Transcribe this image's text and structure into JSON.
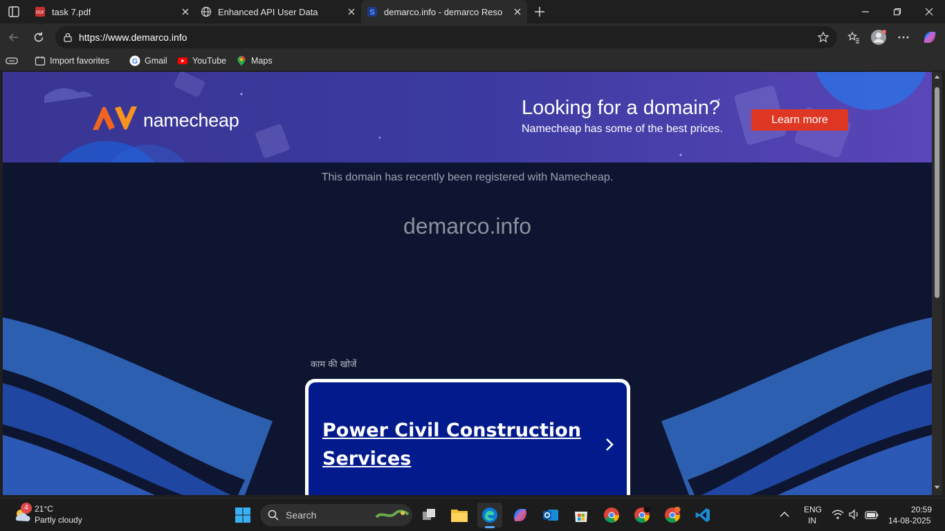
{
  "tabs": [
    {
      "title": "task 7.pdf",
      "icon": "pdf-icon"
    },
    {
      "title": "Enhanced API User Data",
      "icon": "globe-icon"
    },
    {
      "title": "demarco.info - demarco Resource",
      "icon": "site-icon"
    }
  ],
  "address_bar": {
    "url": "https://www.demarco.info"
  },
  "bookmarks": [
    {
      "label": "Import favorites"
    },
    {
      "label": "Gmail"
    },
    {
      "label": "YouTube"
    },
    {
      "label": "Maps"
    }
  ],
  "banner": {
    "brand": "namecheap",
    "headline": "Looking for a domain?",
    "subtext": "Namecheap has some of the best prices.",
    "cta": "Learn more"
  },
  "page": {
    "registered_text": "This domain has recently been registered with Namecheap.",
    "domain": "demarco.info",
    "search_label": "काम की खोजें",
    "card_link": "Power Civil Construction Services"
  },
  "taskbar": {
    "weather": {
      "temp": "21°C",
      "condition": "Partly cloudy",
      "badge": "4"
    },
    "search_label": "Search",
    "lang": {
      "line1": "ENG",
      "line2": "IN"
    },
    "time": "20:59",
    "date": "14-08-2025"
  },
  "colors": {
    "accent_orange": "#de3723",
    "banner_purple": "#3b3aa0",
    "page_bg": "#0e1530",
    "card_blue": "#021a8c"
  }
}
